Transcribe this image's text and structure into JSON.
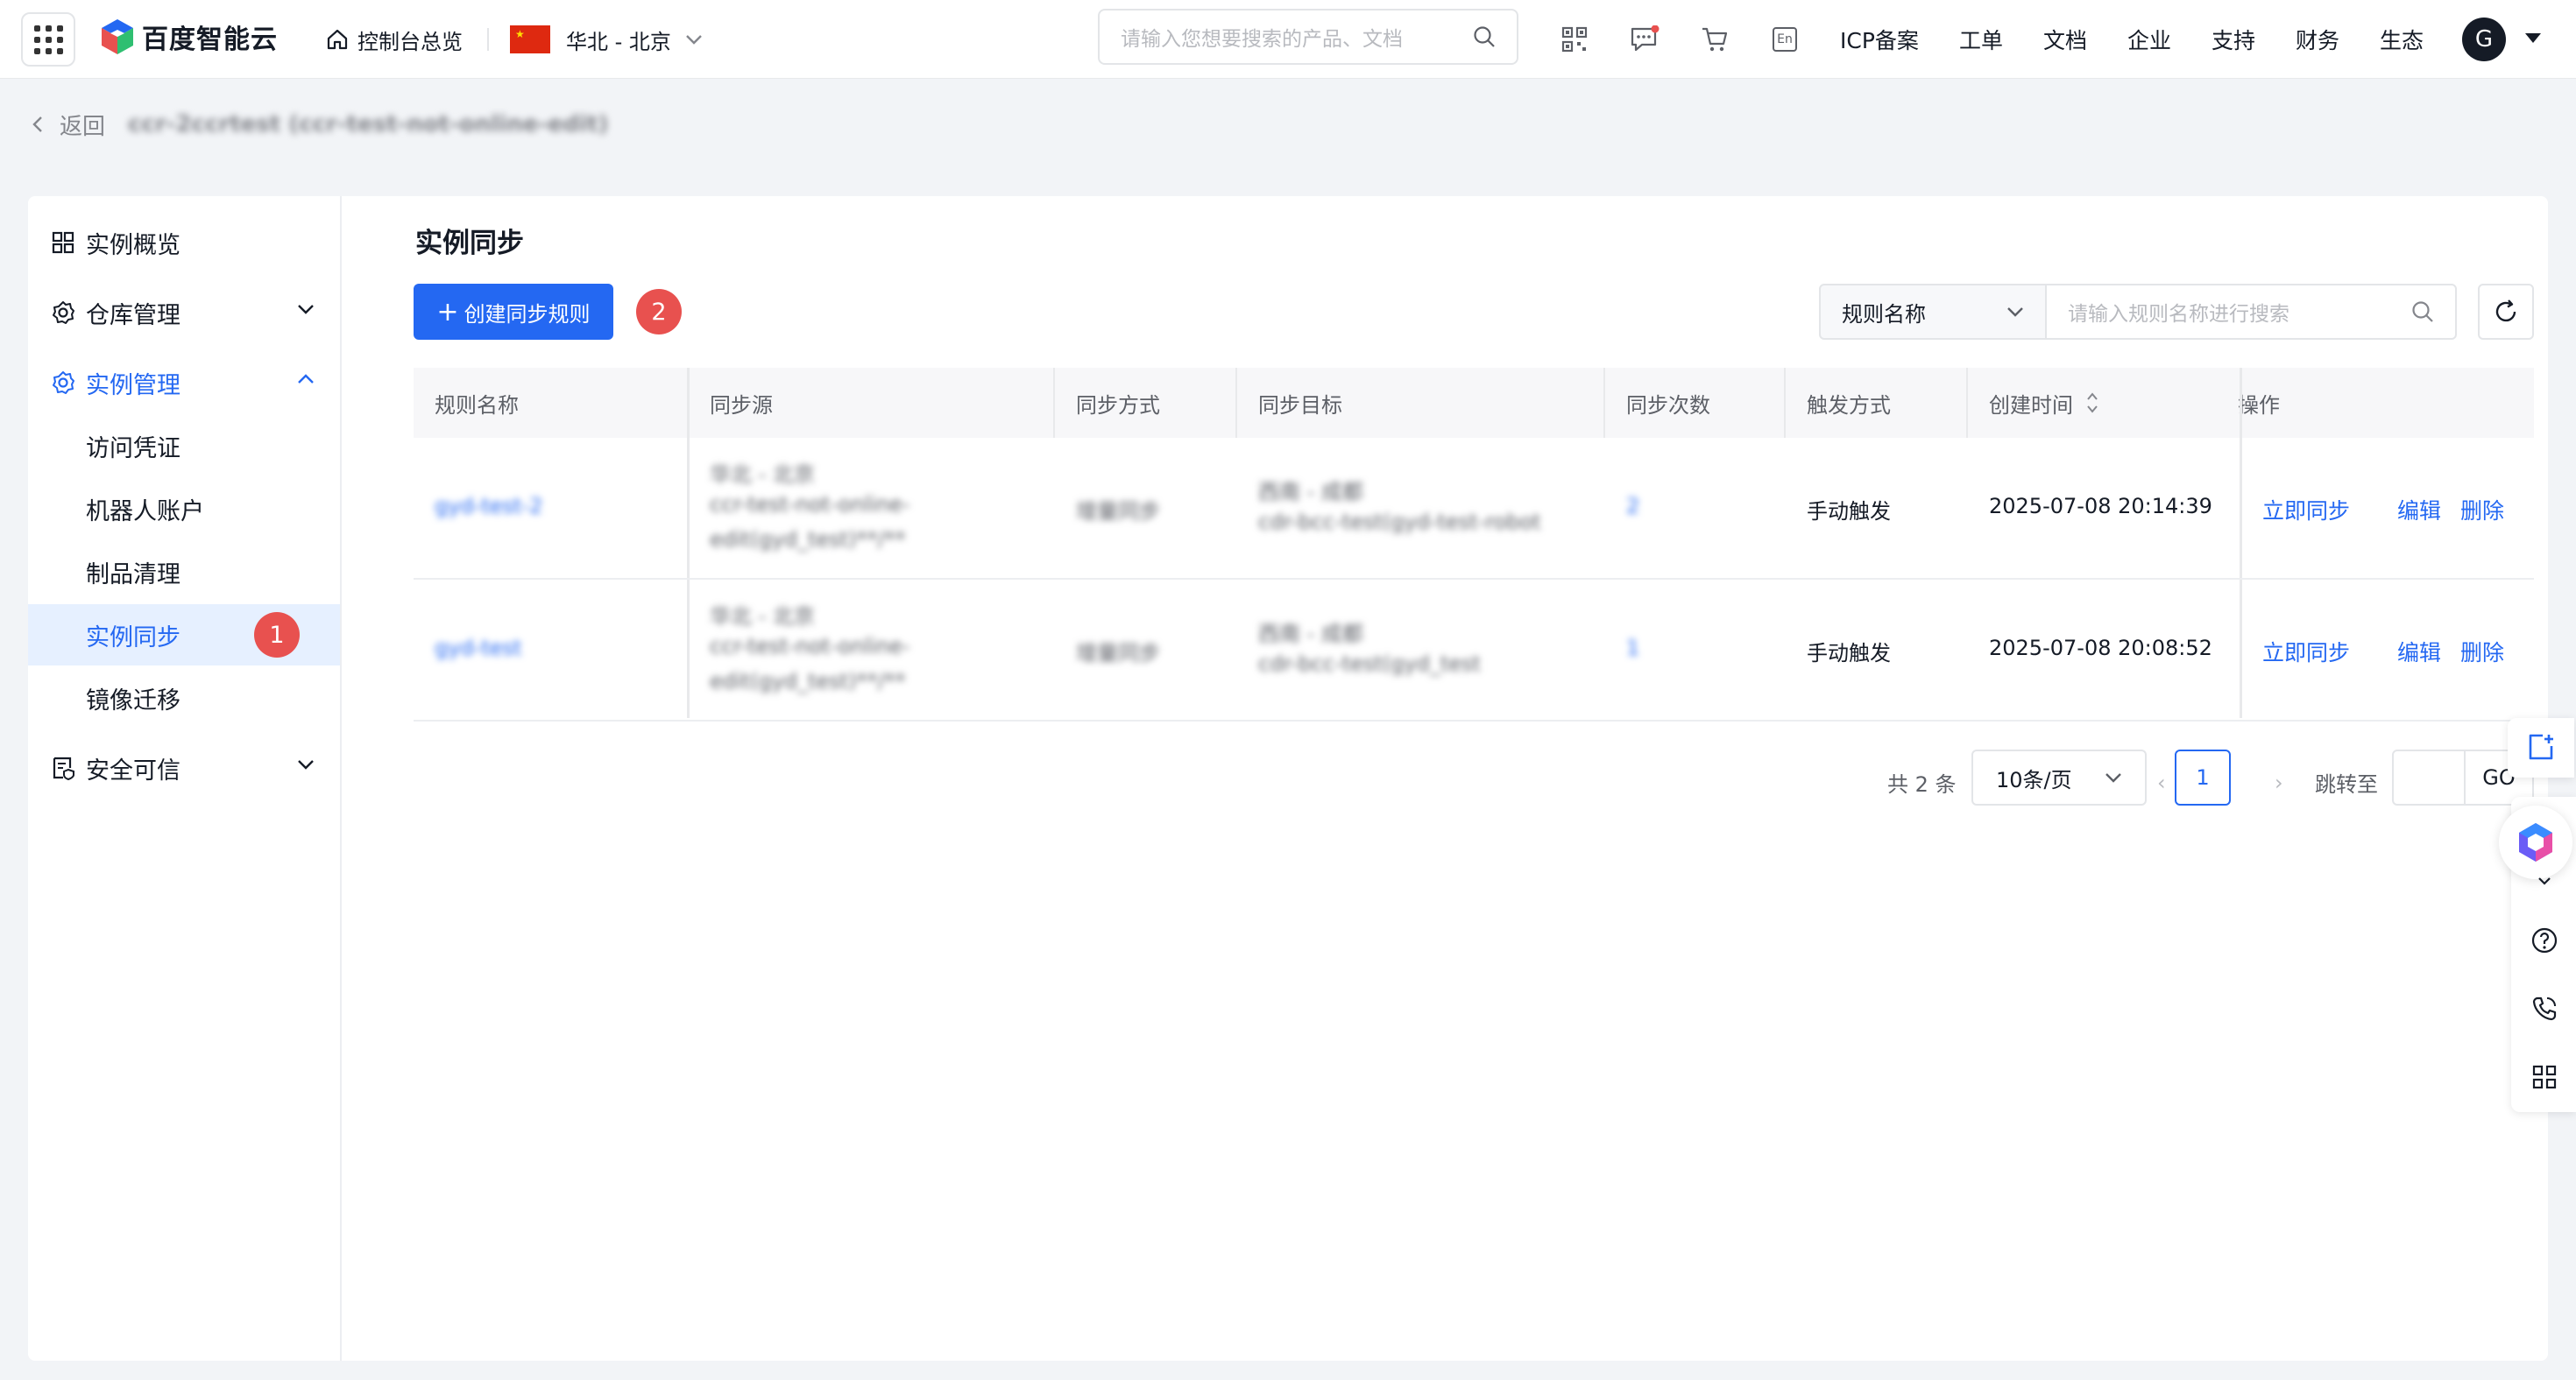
{
  "header": {
    "logo_text": "百度智能云",
    "console_home": "控制台总览",
    "region": "华北 - 北京",
    "search_placeholder": "请输入您想要搜索的产品、文档",
    "links": [
      "ICP备案",
      "工单",
      "文档",
      "企业",
      "支持",
      "财务",
      "生态"
    ],
    "avatar_letter": "G",
    "lang_icon": "En"
  },
  "breadcrumb": {
    "back_label": "返回",
    "instance_title": "ccr-2ccrtest (ccr-test-not-online-edit)"
  },
  "sidebar": {
    "items": [
      {
        "label": "实例概览"
      },
      {
        "label": "仓库管理"
      },
      {
        "label": "实例管理"
      },
      {
        "label": "访问凭证"
      },
      {
        "label": "机器人账户"
      },
      {
        "label": "制品清理"
      },
      {
        "label": "实例同步"
      },
      {
        "label": "镜像迁移"
      },
      {
        "label": "安全可信"
      }
    ],
    "badge": "1"
  },
  "main": {
    "title": "实例同步",
    "create_button": "创建同步规则",
    "create_badge": "2",
    "filter_select": "规则名称",
    "filter_placeholder": "请输入规则名称进行搜索"
  },
  "table": {
    "columns": [
      "规则名称",
      "同步源",
      "同步方式",
      "同步目标",
      "同步次数",
      "触发方式",
      "创建时间",
      "操作"
    ],
    "rows": [
      {
        "name": "gyd-test-2",
        "source_region": "华北 - 北京",
        "source_line1": "ccr-test-not-online-",
        "source_line2": "edit(gyd_test)**/**",
        "mode": "增量同步",
        "target_region": "西南 - 成都",
        "target_line": "cdr-bcc-test(gyd-test-robot",
        "count": "2",
        "trigger": "手动触发",
        "created": "2025-07-08 20:14:39"
      },
      {
        "name": "gyd-test",
        "source_region": "华北 - 北京",
        "source_line1": "ccr-test-not-online-",
        "source_line2": "edit(gyd_test)**/**",
        "mode": "增量同步",
        "target_region": "西南 - 成都",
        "target_line": "cdr-bcc-test(gyd_test",
        "count": "1",
        "trigger": "手动触发",
        "created": "2025-07-08 20:08:52"
      }
    ],
    "ops": [
      "立即同步",
      "编辑",
      "删除"
    ]
  },
  "pagination": {
    "total": "共 2 条",
    "page_size": "10条/页",
    "current": "1",
    "jump_label": "跳转至",
    "go": "GO"
  },
  "colors": {
    "primary": "#2468f2",
    "badge": "#e8514f",
    "active_bg": "#e6f0ff"
  }
}
